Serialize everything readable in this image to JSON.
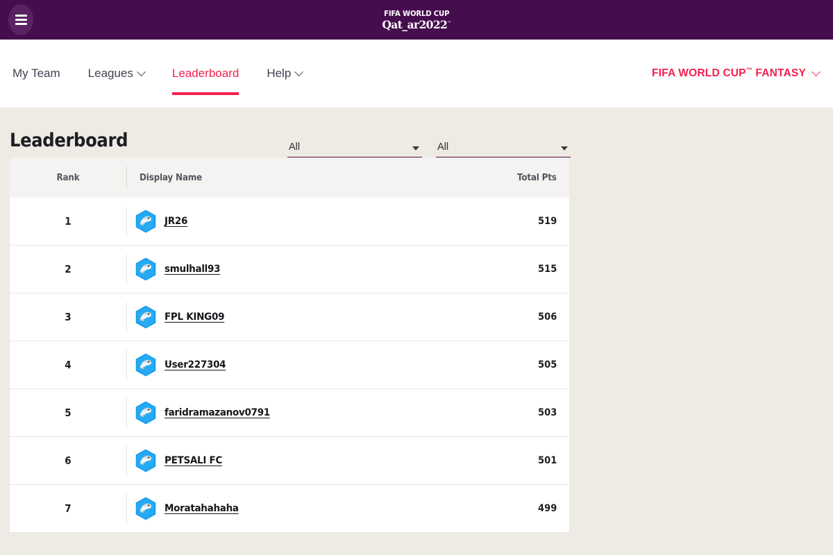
{
  "topbar": {
    "menu_icon": "hamburger-icon",
    "logo": {
      "line1": "FIFA WORLD CUP",
      "line2": "Qat_ar2022",
      "tm": "™"
    }
  },
  "nav": {
    "items": [
      {
        "label": "My Team",
        "has_caret": false,
        "active": false
      },
      {
        "label": "Leagues",
        "has_caret": true,
        "active": false
      },
      {
        "label": "Leaderboard",
        "has_caret": false,
        "active": true
      },
      {
        "label": "Help",
        "has_caret": true,
        "active": false
      }
    ],
    "account": {
      "label": "FIFA WORLD CUP",
      "tm": "™",
      "label_tail": " FANTASY",
      "caret_icon": "chevron-down-icon"
    }
  },
  "page": {
    "title": "Leaderboard",
    "filters": [
      {
        "label": "",
        "value": "All",
        "arrow_icon": "caret-down-icon"
      },
      {
        "label": "",
        "value": "All",
        "arrow_icon": "caret-down-icon"
      }
    ]
  },
  "leaderboard": {
    "columns": {
      "rank": "Rank",
      "name": "Display Name",
      "points": "Total Pts"
    },
    "rows": [
      {
        "rank": "1",
        "name": "JR26",
        "points": "519",
        "avatar": "laeeb-mascot-avatar"
      },
      {
        "rank": "2",
        "name": "smulhall93",
        "points": "515",
        "avatar": "laeeb-mascot-avatar"
      },
      {
        "rank": "3",
        "name": "FPL KING09",
        "points": "506",
        "avatar": "laeeb-mascot-avatar"
      },
      {
        "rank": "4",
        "name": "User227304",
        "points": "505",
        "avatar": "laeeb-mascot-avatar"
      },
      {
        "rank": "5",
        "name": "faridramazanov0791",
        "points": "503",
        "avatar": "laeeb-mascot-avatar"
      },
      {
        "rank": "6",
        "name": "PETSALI FC",
        "points": "501",
        "avatar": "laeeb-mascot-avatar"
      },
      {
        "rank": "7",
        "name": "Moratahahaha",
        "points": "499",
        "avatar": "laeeb-mascot-avatar"
      }
    ]
  },
  "colors": {
    "header_purple": "#460d4e",
    "accent_pink": "#f5204f",
    "page_bg": "#edebe3",
    "underline_purple": "#5c0b4e",
    "avatar_blue": "#18a0f0"
  }
}
